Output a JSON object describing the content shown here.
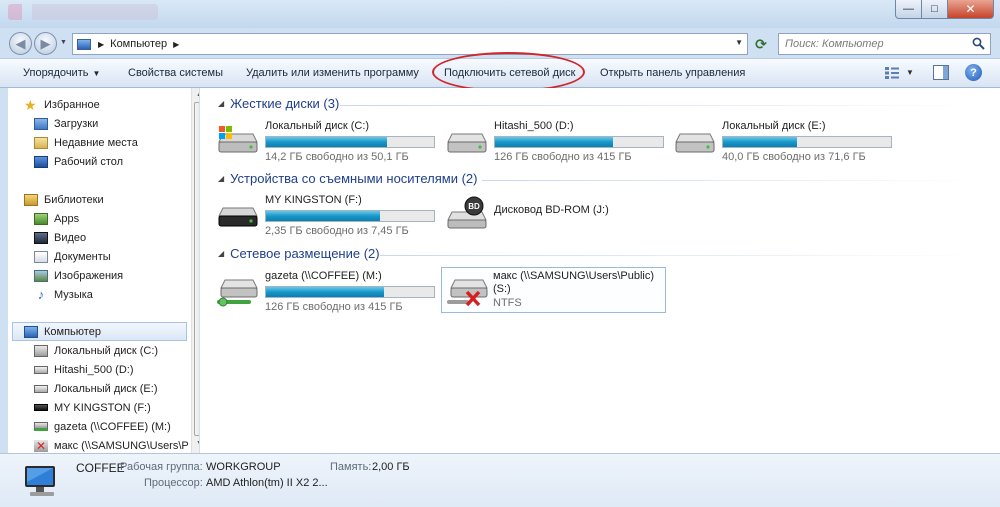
{
  "window": {
    "minimize_glyph": "—",
    "maximize_glyph": "□",
    "close_glyph": "✕"
  },
  "nav": {
    "back_glyph": "◀",
    "forward_glyph": "▶",
    "breadcrumb": "Компьютер",
    "search_placeholder": "Поиск: Компьютер"
  },
  "commands": {
    "organize": "Упорядочить",
    "system_properties": "Свойства системы",
    "uninstall": "Удалить или изменить программу",
    "map_drive": "Подключить сетевой диск",
    "control_panel": "Открыть панель управления"
  },
  "sidebar": {
    "favorites": {
      "label": "Избранное",
      "items": [
        "Загрузки",
        "Недавние места",
        "Рабочий стол"
      ]
    },
    "libraries": {
      "label": "Библиотеки",
      "items": [
        "Apps",
        "Видео",
        "Документы",
        "Изображения",
        "Музыка"
      ]
    },
    "computer": {
      "label": "Компьютер",
      "items": [
        "Локальный диск (C:)",
        "Hitashi_500 (D:)",
        "Локальный диск (E:)",
        "MY KINGSTON (F:)",
        "gazeta (\\\\COFFEE) (M:)",
        "макс (\\\\SAMSUNG\\Users\\P"
      ]
    }
  },
  "groups": [
    {
      "title": "Жесткие диски (3)",
      "drives": [
        {
          "name": "Локальный диск (C:)",
          "info": "14,2 ГБ свободно из 50,1 ГБ",
          "used_fraction": 0.72,
          "icon": "windows-drive-icon"
        },
        {
          "name": "Hitashi_500 (D:)",
          "info": "126 ГБ свободно из 415 ГБ",
          "used_fraction": 0.7,
          "icon": "hard-drive-icon"
        },
        {
          "name": "Локальный диск (E:)",
          "info": "40,0 ГБ свободно из 71,6 ГБ",
          "used_fraction": 0.44,
          "icon": "hard-drive-icon"
        }
      ]
    },
    {
      "title": "Устройства со съемными носителями (2)",
      "drives": [
        {
          "name": "MY KINGSTON (F:)",
          "info": "2,35 ГБ свободно из 7,45 ГБ",
          "used_fraction": 0.68,
          "icon": "usb-drive-icon"
        },
        {
          "name": "Дисковод BD-ROM (J:)",
          "badge": "BD",
          "icon": "bd-rom-drive-icon"
        }
      ]
    },
    {
      "title": "Сетевое размещение (2)",
      "drives": [
        {
          "name": "gazeta (\\\\COFFEE) (M:)",
          "info": "126 ГБ свободно из 415 ГБ",
          "used_fraction": 0.7,
          "icon": "network-drive-icon"
        },
        {
          "name": "макс (\\\\SAMSUNG\\Users\\Public)",
          "name2": "(S:)",
          "info": "NTFS",
          "icon": "disconnected-network-drive-icon"
        }
      ]
    }
  ],
  "details": {
    "computer_name": "COFFEE",
    "workgroup_label": "Рабочая группа:",
    "workgroup_value": "WORKGROUP",
    "memory_label": "Память:",
    "memory_value": "2,00 ГБ",
    "cpu_label": "Процессор:",
    "cpu_value": "AMD Athlon(tm) II X2 2..."
  },
  "colors": {
    "accent_blue": "#1f3f8a",
    "bar_fill": "#1998c8",
    "highlight_ring": "#d0262a"
  }
}
